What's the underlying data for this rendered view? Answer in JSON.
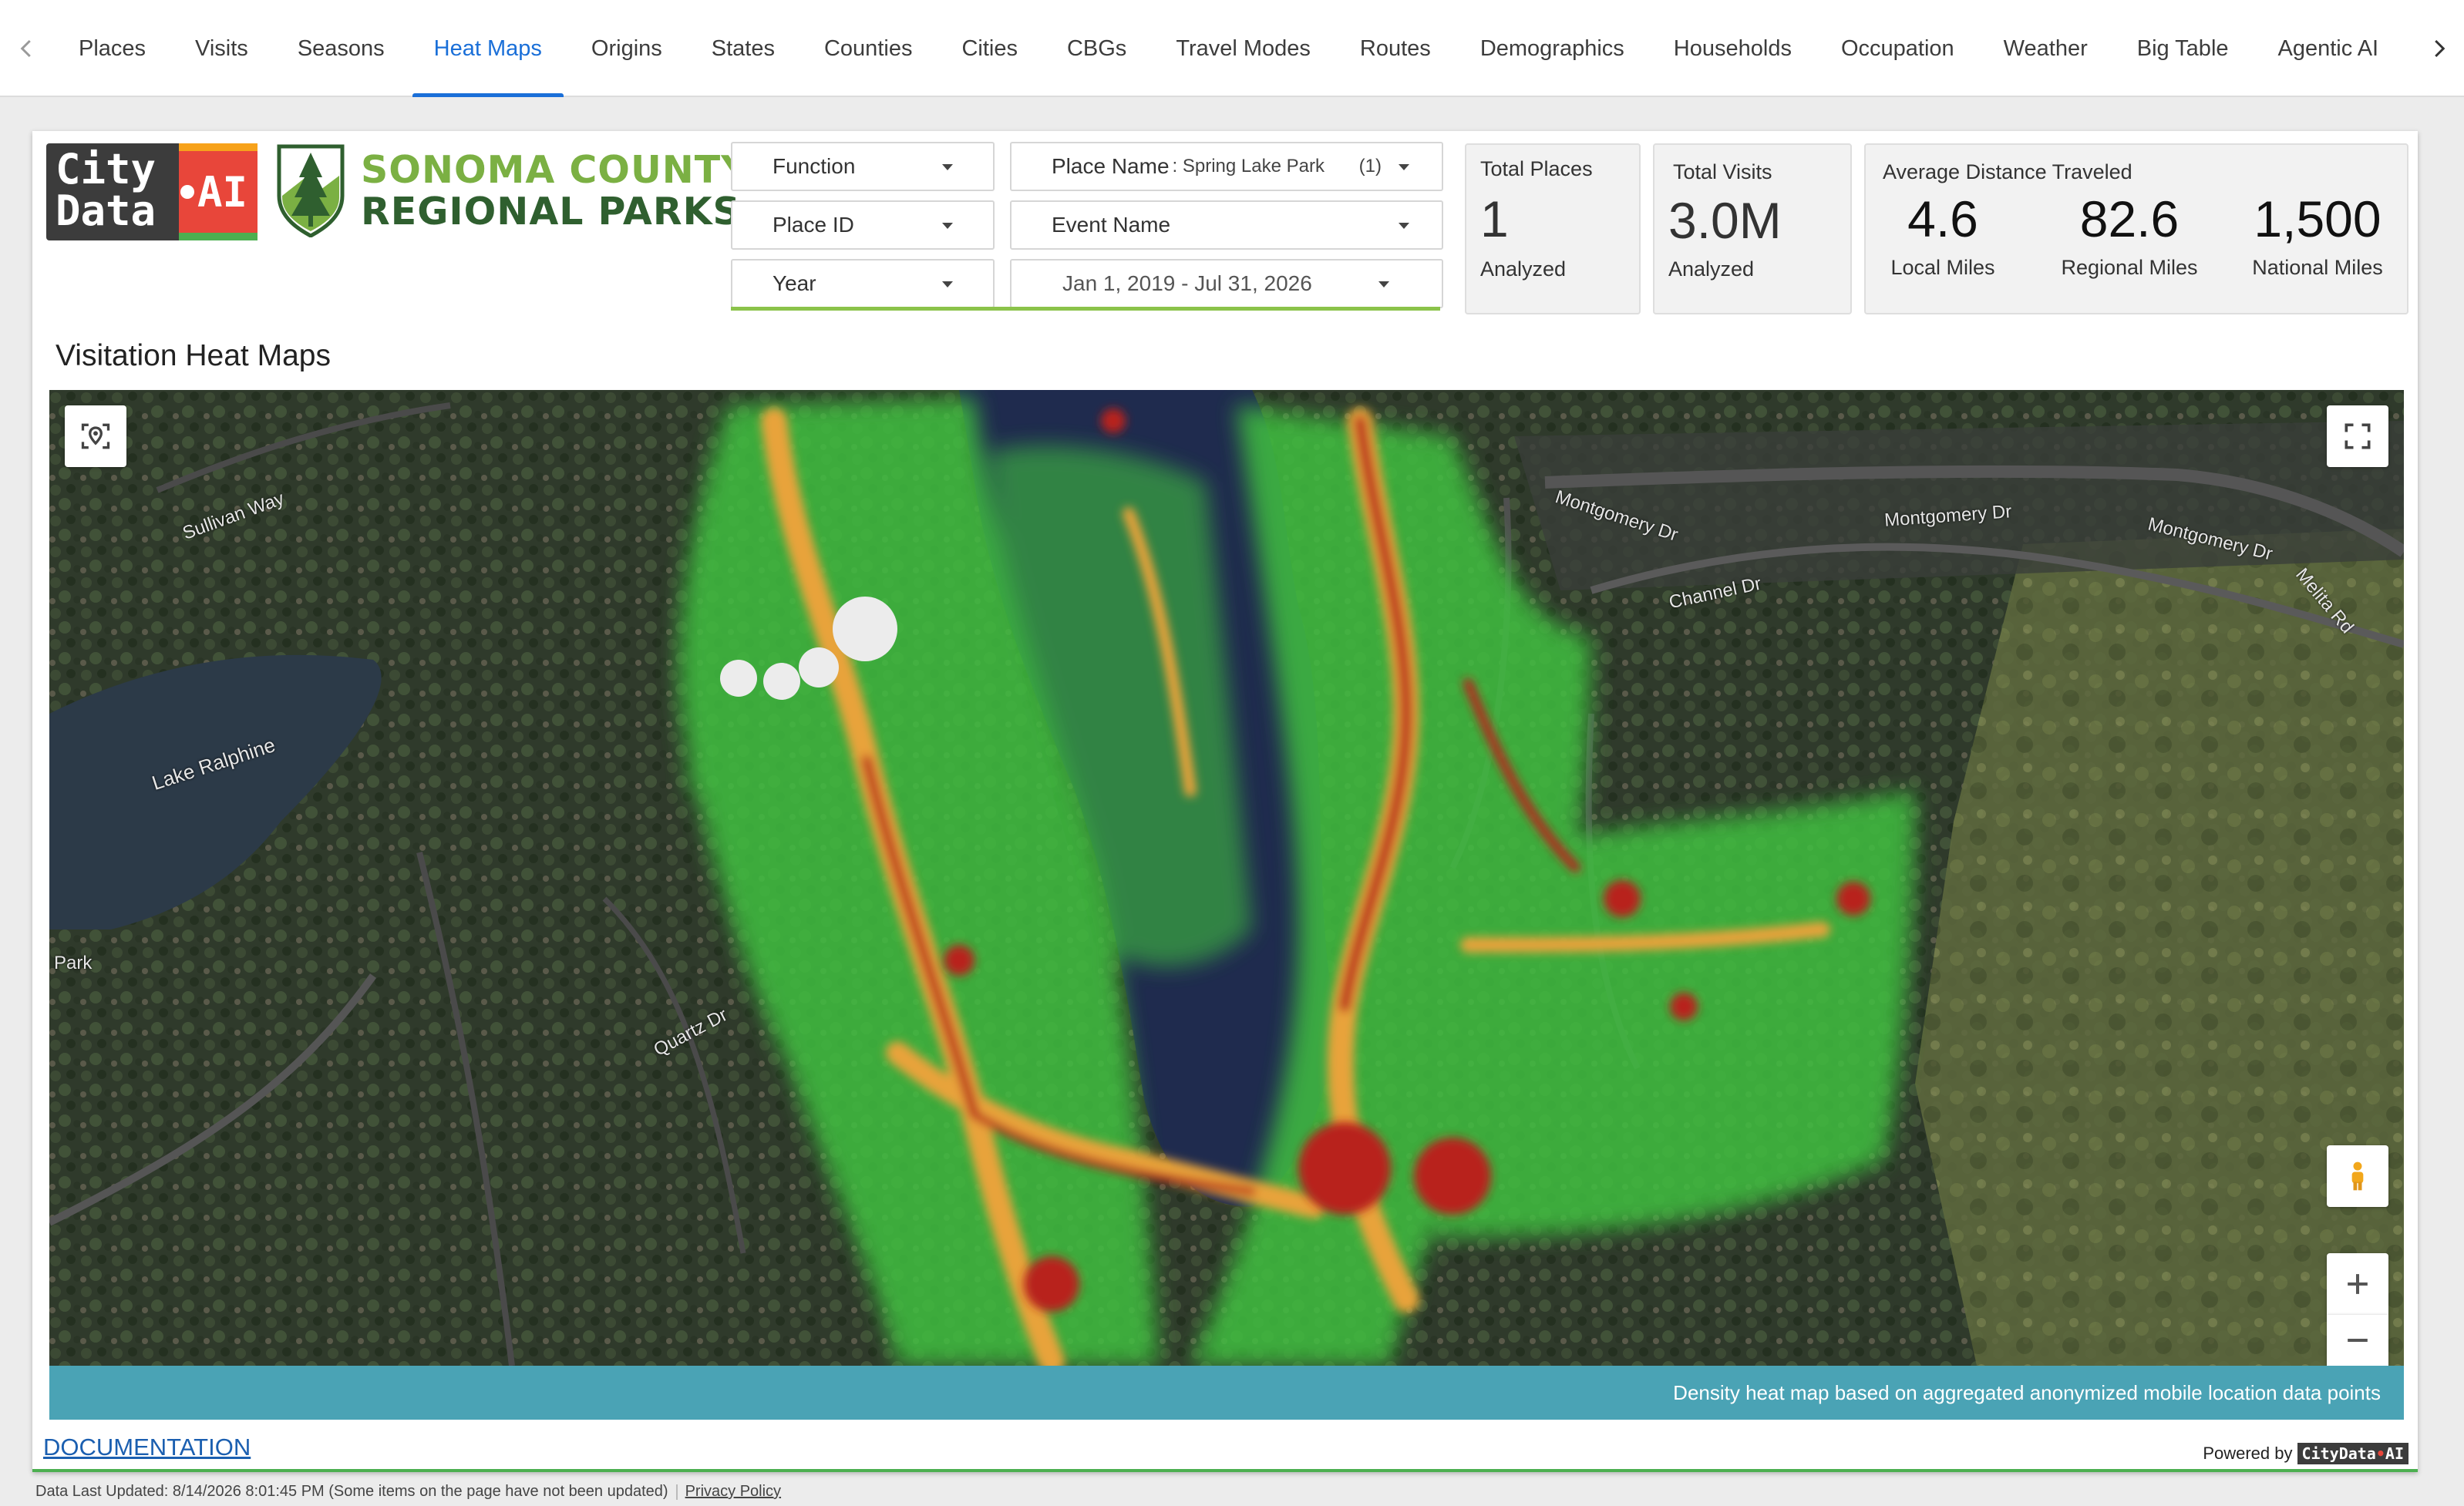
{
  "nav": {
    "tabs": [
      {
        "label": "Places"
      },
      {
        "label": "Visits"
      },
      {
        "label": "Seasons"
      },
      {
        "label": "Heat Maps"
      },
      {
        "label": "Origins"
      },
      {
        "label": "States"
      },
      {
        "label": "Counties"
      },
      {
        "label": "Cities"
      },
      {
        "label": "CBGs"
      },
      {
        "label": "Travel Modes"
      },
      {
        "label": "Routes"
      },
      {
        "label": "Demographics"
      },
      {
        "label": "Households"
      },
      {
        "label": "Occupation"
      },
      {
        "label": "Weather"
      },
      {
        "label": "Big Table"
      },
      {
        "label": "Agentic AI"
      }
    ],
    "active_tab": "Heat Maps"
  },
  "branding": {
    "citydata_line1": "City",
    "citydata_line2": "Data",
    "citydata_ai": "AI",
    "sonoma_line1": "SONOMA COUNTY",
    "sonoma_line2": "REGIONAL PARKS"
  },
  "filters": {
    "function": "Function",
    "place_id": "Place ID",
    "year": "Year",
    "place_name_label": "Place Name",
    "place_name_value": ": Spring Lake Park",
    "place_name_count": "(1)",
    "event_name": "Event Name",
    "date_range": "Jan 1, 2019 - Jul 31, 2026"
  },
  "stats": {
    "total_places": {
      "label": "Total Places",
      "value": "1",
      "sub": "Analyzed"
    },
    "total_visits": {
      "label": "Total Visits",
      "value": "3.0M",
      "sub": "Analyzed"
    },
    "distance": {
      "label": "Average Distance Traveled",
      "local": {
        "value": "4.6",
        "unit": "Local Miles"
      },
      "regional": {
        "value": "82.6",
        "unit": "Regional Miles"
      },
      "national": {
        "value": "1,500",
        "unit": "National Miles"
      }
    }
  },
  "section_title": "Visitation Heat Maps",
  "map": {
    "labels": {
      "lake": "Lake Ralphine",
      "montgomery1": "Montgomery Dr",
      "montgomery2": "Montgomery Dr",
      "montgomery3": "Montgomery Dr",
      "channel": "Channel Dr",
      "melita": "Melita Rd",
      "sullivan": "Sullivan Way",
      "quartz": "Quartz Dr",
      "park": "Park"
    },
    "caption": "Density heat map based on aggregated anonymized mobile location data points",
    "icons": [
      "locate-icon",
      "fullscreen-icon",
      "pegman-icon",
      "zoom-in-icon",
      "zoom-out-icon"
    ]
  },
  "documentation_link": "DOCUMENTATION",
  "powered_by": "Powered by",
  "footer": {
    "updated": "Data Last Updated: 8/14/2026 8:01:45 PM (Some items on the page have not been updated)",
    "privacy": "Privacy Policy"
  },
  "colors": {
    "accent": "#1a6fd8",
    "caption_bar": "#4aa3b5",
    "heat_low": "#3fbf3f",
    "heat_mid": "#e8a33a",
    "heat_high": "#b8231e"
  }
}
